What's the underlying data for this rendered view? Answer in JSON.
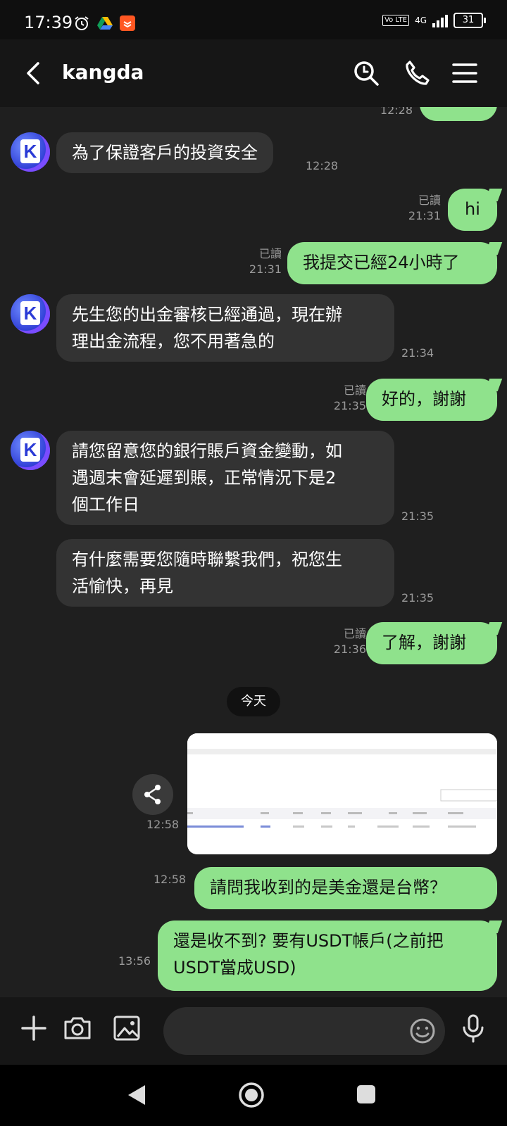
{
  "status_bar": {
    "time": "17:39",
    "network": "4G",
    "volte": "Vo LTE",
    "battery": "31"
  },
  "header": {
    "title": "kangda"
  },
  "messages": {
    "top_partial_time": "12:28",
    "m1": {
      "text": "為了保證客戶的投資安全",
      "time": "12:28"
    },
    "m2": {
      "text": "hi",
      "read": "已讀",
      "time": "21:31"
    },
    "m3": {
      "text": "我提交已經24小時了",
      "read": "已讀",
      "time": "21:31"
    },
    "m4": {
      "line1": "先生您的出金審核已經通過，現在辦",
      "line2": "理出金流程，您不用著急的",
      "time": "21:34"
    },
    "m5": {
      "text": "好的，謝謝",
      "read": "已讀",
      "time": "21:35"
    },
    "m6": {
      "line1": "請您留意您的銀行賬戶資金變動，如",
      "line2": "遇週末會延遲到賬，正常情況下是2",
      "line3": "個工作日",
      "time": "21:35"
    },
    "m7": {
      "line1": "有什麼需要您隨時聯繫我們，祝您生",
      "line2": "活愉快，再見",
      "time": "21:35"
    },
    "m8": {
      "text": "了解，謝謝",
      "read": "已讀",
      "time": "21:36"
    },
    "date_divider": "今天",
    "image_time": "12:58",
    "m9": {
      "text": "請問我收到的是美金還是台幣？",
      "time": "12:58"
    },
    "m10": {
      "line1": "還是收不到? 要有USDT帳戶(之前把",
      "line2": "USDT當成USD)",
      "time": "13:56"
    }
  },
  "input": {
    "placeholder": ""
  },
  "colors": {
    "outgoing_bubble": "#8fe28c",
    "incoming_bubble": "#333333",
    "background": "#1f1f1f"
  },
  "icons": [
    "back-icon",
    "search-icon",
    "phone-icon",
    "menu-icon",
    "plus-icon",
    "camera-icon",
    "image-icon",
    "emoji-icon",
    "mic-icon",
    "share-icon",
    "nav-back-icon",
    "nav-home-icon",
    "nav-recents-icon"
  ]
}
